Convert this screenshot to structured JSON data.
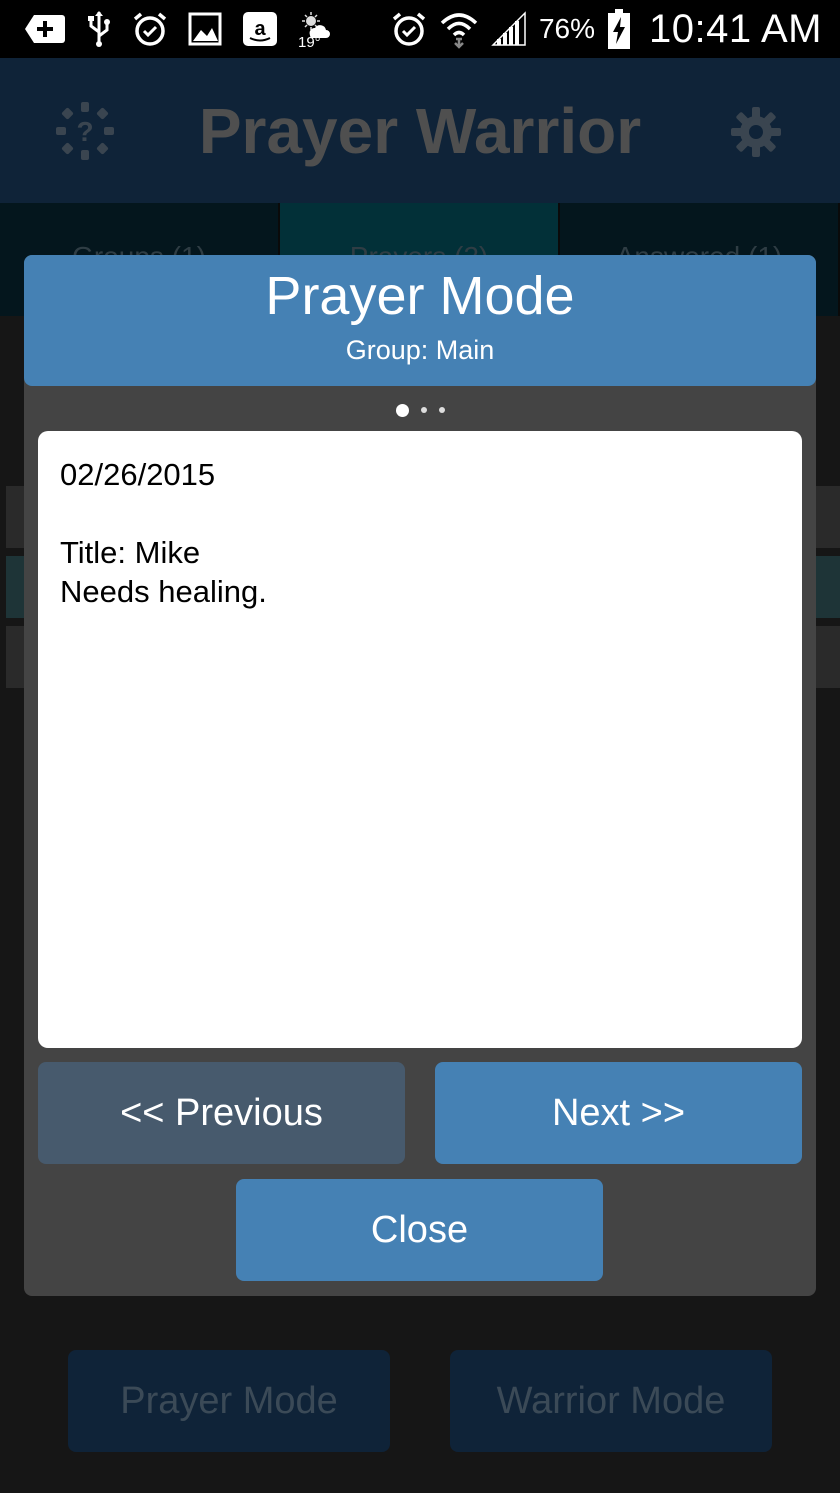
{
  "status_bar": {
    "left_icons": [
      "add-box-icon",
      "usb-icon",
      "alarm-icon",
      "gallery-icon",
      "amazon-icon"
    ],
    "weather_temp": "19°",
    "right_icons": [
      "alarm-icon",
      "wifi-icon",
      "signal-icon",
      "battery-charging-icon"
    ],
    "battery_percent": "76%",
    "time": "10:41 AM"
  },
  "app": {
    "title": "Prayer Warrior",
    "tabs": [
      {
        "label": "Groups (1)",
        "active": false
      },
      {
        "label": "Prayers (2)",
        "active": true
      },
      {
        "label": "Answered (1)",
        "active": false
      }
    ],
    "bottom_buttons": {
      "prayer_mode": "Prayer Mode",
      "warrior_mode": "Warrior Mode"
    }
  },
  "dialog": {
    "title": "Prayer Mode",
    "subtitle": "Group: Main",
    "page_count": 3,
    "current_page": 1,
    "card": {
      "date": "02/26/2015",
      "title_line": "Title: Mike",
      "body": "Needs healing."
    },
    "buttons": {
      "previous": "<< Previous",
      "next": "Next >>",
      "close": "Close"
    }
  },
  "colors": {
    "dialog_accent": "#4581b4",
    "previous_button": "#475a6d",
    "dialog_bg": "#444444"
  }
}
